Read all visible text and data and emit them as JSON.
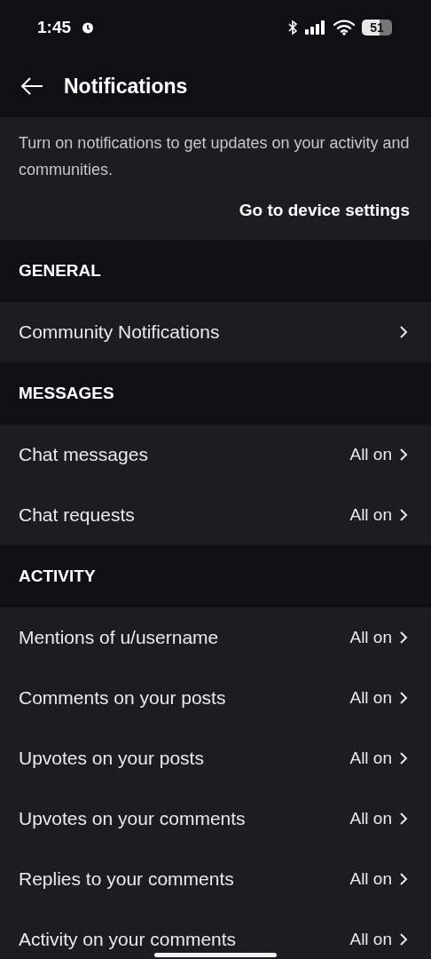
{
  "status_bar": {
    "time": "1:45",
    "battery": "51"
  },
  "header": {
    "title": "Notifications"
  },
  "info": {
    "text": "Turn on notifications to get updates on your activity and communities.",
    "link": "Go to device settings"
  },
  "sections": [
    {
      "title": "GENERAL",
      "rows": [
        {
          "label": "Community Notifications"
        }
      ]
    },
    {
      "title": "MESSAGES",
      "rows": [
        {
          "label": "Chat messages",
          "value": "All on"
        },
        {
          "label": "Chat requests",
          "value": "All on"
        }
      ]
    },
    {
      "title": "ACTIVITY",
      "rows": [
        {
          "label": "Mentions of u/username",
          "value": "All on"
        },
        {
          "label": "Comments on your posts",
          "value": "All on"
        },
        {
          "label": "Upvotes on your posts",
          "value": "All on"
        },
        {
          "label": "Upvotes on your comments",
          "value": "All on"
        },
        {
          "label": "Replies to your comments",
          "value": "All on"
        },
        {
          "label": "Activity on your comments",
          "value": "All on"
        }
      ]
    }
  ]
}
